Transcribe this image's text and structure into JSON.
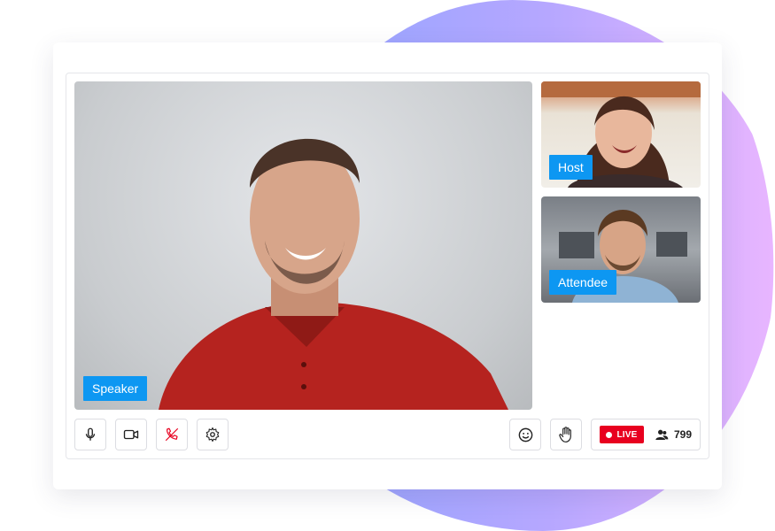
{
  "participants": {
    "speaker": {
      "label": "Speaker"
    },
    "host": {
      "label": "Host"
    },
    "attendee": {
      "label": "Attendee"
    }
  },
  "live": {
    "badge_label": "LIVE",
    "viewer_count": "799"
  },
  "icons": {
    "mic": "microphone-icon",
    "camera": "video-camera-icon",
    "end_call": "phone-off-icon",
    "settings": "gear-icon",
    "emoji": "smiley-icon",
    "raise_hand": "hand-icon",
    "viewers": "people-icon"
  },
  "colors": {
    "label_bg": "#0d97f2",
    "live_red": "#e8001f",
    "end_call_red": "#e8001f"
  }
}
